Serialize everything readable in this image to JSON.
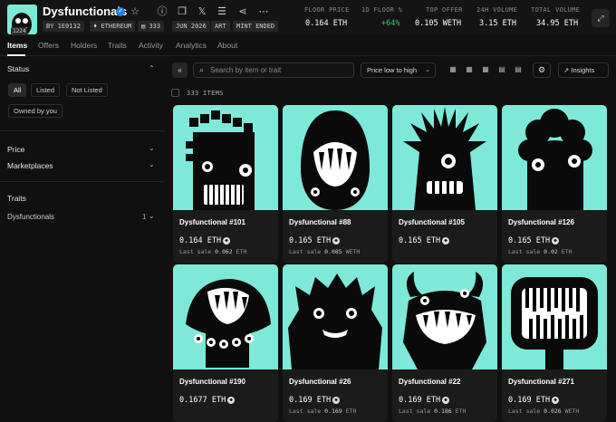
{
  "collection": {
    "name": "Dysfunctionals",
    "avatar_badge": "1224",
    "chips": [
      "BY 1E0132",
      "ETHEREUM",
      "333",
      "JUN 2026",
      "ART",
      "MINT ENDED"
    ]
  },
  "stats": [
    {
      "label": "FLOOR PRICE",
      "value": "0.164 ETH"
    },
    {
      "label": "1D FLOOR %",
      "value": "+64%"
    },
    {
      "label": "TOP OFFER",
      "value": "0.105 WETH"
    },
    {
      "label": "24H VOLUME",
      "value": "3.15 ETH"
    },
    {
      "label": "TOTAL VOLUME",
      "value": "34.95 ETH"
    }
  ],
  "tabs": [
    "Items",
    "Offers",
    "Holders",
    "Traits",
    "Activity",
    "Analytics",
    "About"
  ],
  "sidebar": {
    "status_title": "Status",
    "status_pills": [
      "All",
      "Listed",
      "Not Listed",
      "Owned by you"
    ],
    "price_title": "Price",
    "marketplaces_title": "Marketplaces",
    "traits_title": "Traits",
    "trait_name": "Dysfunctionals",
    "trait_count": "1"
  },
  "toolbar": {
    "search_placeholder": "Search by item or trait",
    "sort_label": "Price low to high",
    "insights_label": "Insights",
    "items_count": "333 ITEMS"
  },
  "items": [
    {
      "name": "Dysfunctional #101",
      "price": "0.164",
      "currency": "ETH",
      "last_label": "Last sale",
      "last_value": "0.062",
      "last_currency": "ETH",
      "kind": "pixel"
    },
    {
      "name": "Dysfunctional #88",
      "price": "0.165",
      "currency": "ETH",
      "last_label": "Last sale",
      "last_value": "0.085",
      "last_currency": "WETH",
      "kind": "egg"
    },
    {
      "name": "Dysfunctional #105",
      "price": "0.165",
      "currency": "ETH",
      "last_label": "",
      "last_value": "",
      "last_currency": "",
      "kind": "spiky"
    },
    {
      "name": "Dysfunctional #126",
      "price": "0.165",
      "currency": "ETH",
      "last_label": "Last sale",
      "last_value": "0.02",
      "last_currency": "ETH",
      "kind": "curly"
    },
    {
      "name": "Dysfunctional #190",
      "price": "0.1677",
      "currency": "ETH",
      "last_label": "",
      "last_value": "",
      "last_currency": "",
      "kind": "mushroom"
    },
    {
      "name": "Dysfunctional #26",
      "price": "0.169",
      "currency": "ETH",
      "last_label": "Last sale",
      "last_value": "0.169",
      "last_currency": "ETH",
      "kind": "furry"
    },
    {
      "name": "Dysfunctional #22",
      "price": "0.169",
      "currency": "ETH",
      "last_label": "Last sale",
      "last_value": "0.186",
      "last_currency": "ETH",
      "kind": "horned"
    },
    {
      "name": "Dysfunctional #271",
      "price": "0.169",
      "currency": "ETH",
      "last_label": "Last sale",
      "last_value": "0.026",
      "last_currency": "WETH",
      "kind": "box"
    }
  ],
  "colors": {
    "accent_teal": "#7ee9d8",
    "positive": "#35c36b",
    "verified": "#2081e2"
  }
}
